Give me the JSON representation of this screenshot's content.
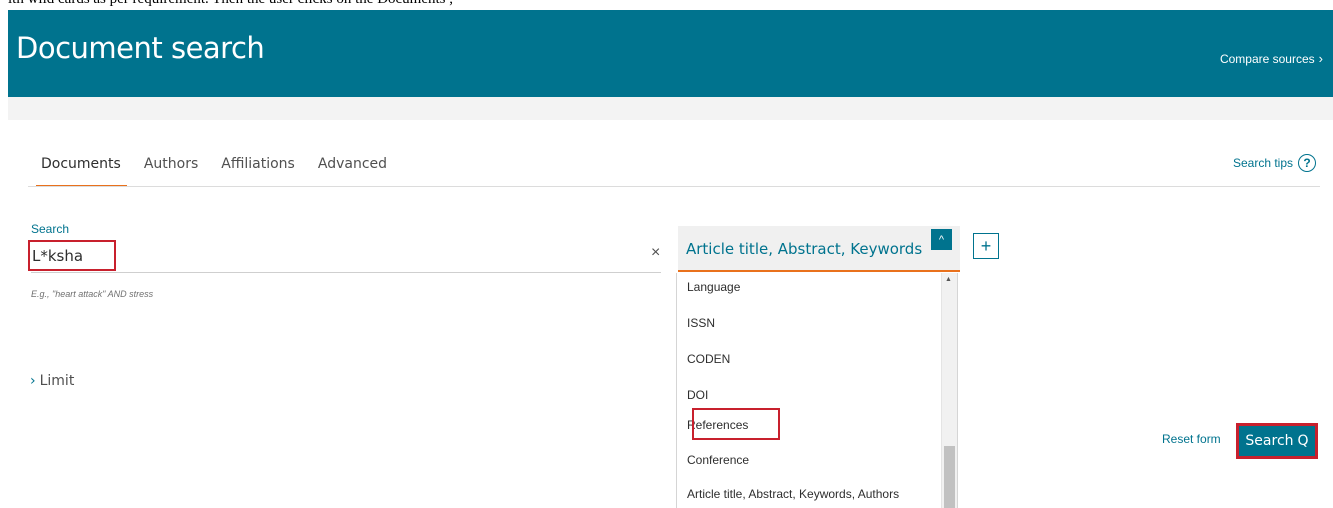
{
  "top_strip_text": "ith wild cards as per requirement. Then the user clicks on the Documents ,",
  "header": {
    "title": "Document search",
    "compare_label": "Compare sources",
    "compare_chevron": "›"
  },
  "tabs": [
    {
      "label": "Documents",
      "active": true
    },
    {
      "label": "Authors",
      "active": false
    },
    {
      "label": "Affiliations",
      "active": false
    },
    {
      "label": "Advanced",
      "active": false
    }
  ],
  "search_tips": {
    "label": "Search tips",
    "icon": "?"
  },
  "search": {
    "label": "Search",
    "value": "L*ksha",
    "clear": "×",
    "hint": "E.g., \"heart attack\" AND stress"
  },
  "field_select": {
    "selected": "Article title, Abstract, Keywords",
    "caret": "^",
    "add_field": "+"
  },
  "dropdown_options": [
    "Language",
    "ISSN",
    "CODEN",
    "DOI",
    "References",
    "Conference",
    "Article title, Abstract, Keywords, Authors"
  ],
  "limit": {
    "chevron": "›",
    "label": "Limit"
  },
  "actions": {
    "reset_label": "Reset form",
    "search_label": "Search",
    "search_icon": "Q"
  },
  "colors": {
    "primary": "#00738e",
    "accent_orange": "#e9711c",
    "highlight_red": "#c8202d"
  }
}
